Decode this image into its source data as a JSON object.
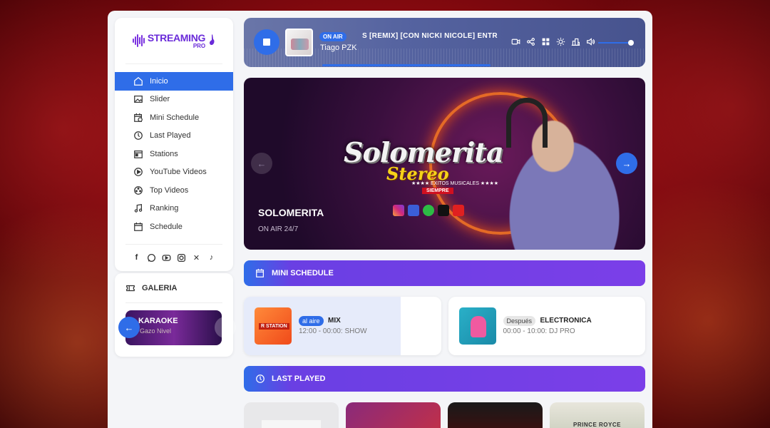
{
  "brand": {
    "name": "STREAMING",
    "tag": "PRO"
  },
  "sidebar": {
    "items": [
      {
        "label": "Inicio",
        "active": true
      },
      {
        "label": "Slider"
      },
      {
        "label": "Mini Schedule"
      },
      {
        "label": "Last Played"
      },
      {
        "label": "Stations"
      },
      {
        "label": "YouTube Videos"
      },
      {
        "label": "Top Videos"
      },
      {
        "label": "Ranking"
      },
      {
        "label": "Schedule"
      }
    ],
    "social_icons": [
      "facebook-icon",
      "whatsapp-icon",
      "youtube-icon",
      "instagram-icon",
      "x-icon",
      "tiktok-icon"
    ]
  },
  "galeria": {
    "title": "GALERIA",
    "image_title": "KARAOKE",
    "image_sub": "Gazo Nivel"
  },
  "player": {
    "status": "ON AIR",
    "track": "S [REMIX] [CON NICKI NICOLE]    ENTR",
    "artist": "Tiago PZK",
    "volume": 0.95,
    "progress": 0.42
  },
  "hero": {
    "logo_main": "Solomerita",
    "logo_sub": "Stereo",
    "logo_tagline": "★★★★ EXITOS MUSICALES ★★★★",
    "logo_badge": "SIEMPRE",
    "title": "SOLOMERITA",
    "subtitle": "ON AIR 24/7"
  },
  "mini_schedule": {
    "title": "MINI SCHEDULE",
    "cards": [
      {
        "badge": "al aire",
        "name": "MIX",
        "time": "12:00 - 00:00: SHOW",
        "thumb_label": "R STATION"
      },
      {
        "badge": "Después",
        "name": "ELECTRONICA",
        "time": "00:00 - 10:00: DJ PRO"
      }
    ]
  },
  "last_played": {
    "title": "LAST PLAYED",
    "cards": [
      {
        "label": ""
      },
      {
        "label": ""
      },
      {
        "label": ""
      },
      {
        "label": "PRINCE ROYCE"
      }
    ]
  },
  "colors": {
    "accent": "#2f6de8",
    "purple": "#7b3fe8",
    "brand": "#6a2bd9"
  }
}
